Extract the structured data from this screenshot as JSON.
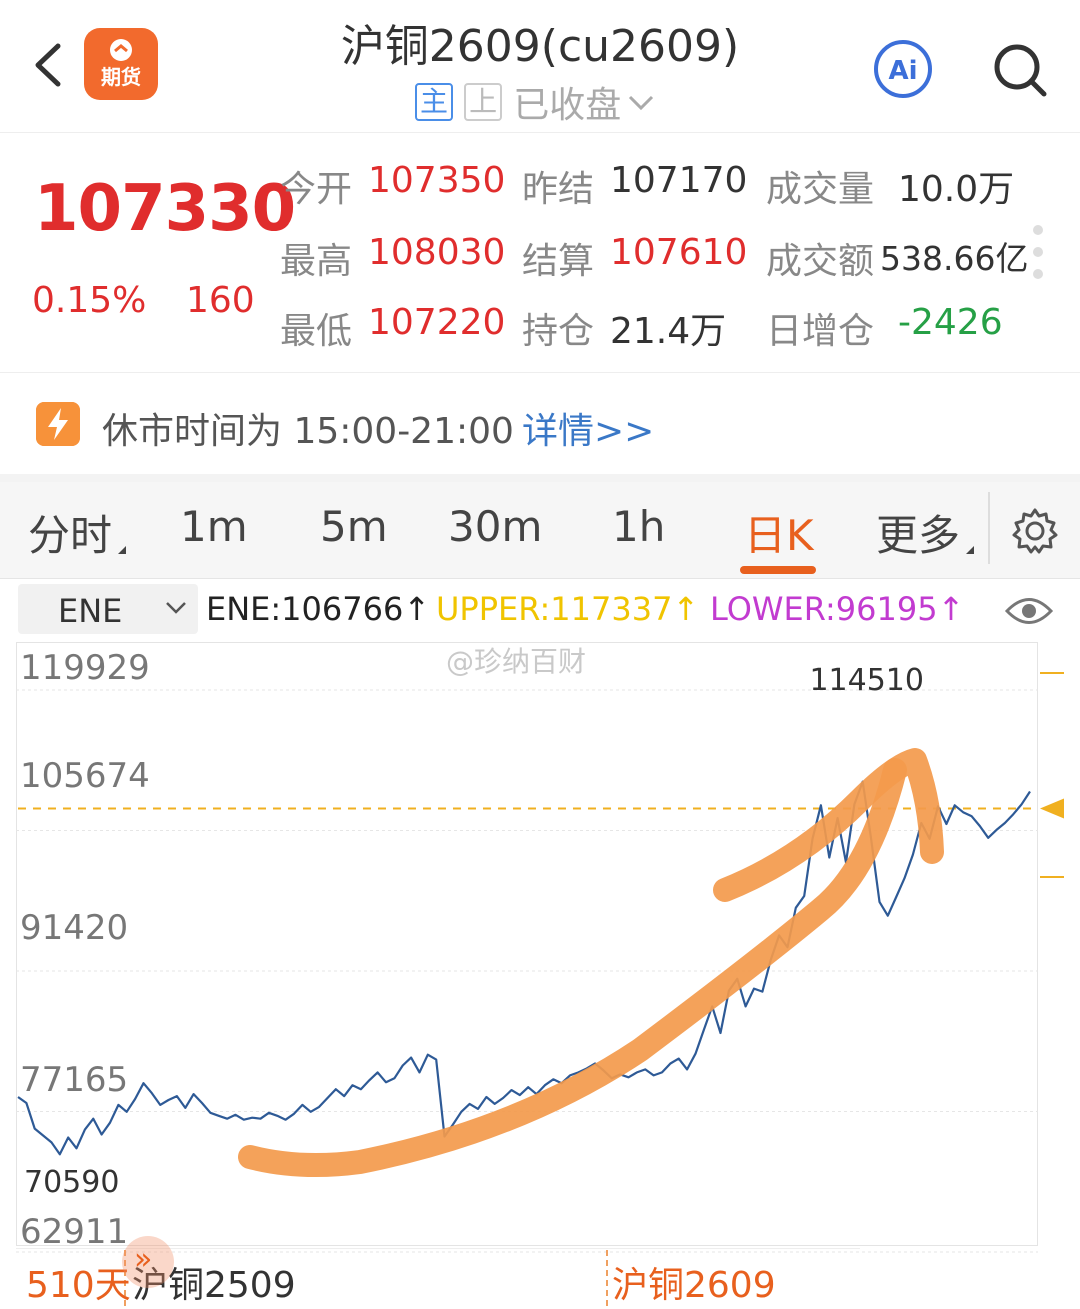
{
  "header": {
    "title": "沪铜2609(cu2609)",
    "tag_main": "主",
    "tag_prev": "上",
    "status": "已收盘",
    "logo_text": "期货"
  },
  "quote": {
    "last_price": "107330",
    "change_pct": "0.15%",
    "change_abs": "160",
    "fields": {
      "open_label": "今开",
      "open_value": "107350",
      "prev_close_label": "昨结",
      "prev_close_value": "107170",
      "volume_label": "成交量",
      "volume_value": "10.0万",
      "high_label": "最高",
      "high_value": "108030",
      "settle_label": "结算",
      "settle_value": "107610",
      "turnover_label": "成交额",
      "turnover_value": "538.66亿",
      "low_label": "最低",
      "low_value": "107220",
      "oi_label": "持仓",
      "oi_value": "21.4万",
      "oi_change_label": "日增仓",
      "oi_change_value": "-2426"
    }
  },
  "notice": {
    "text": "休市时间为 15:00-21:00",
    "link": "详情>>"
  },
  "tabs": [
    {
      "label": "分时"
    },
    {
      "label": "1m"
    },
    {
      "label": "5m"
    },
    {
      "label": "30m"
    },
    {
      "label": "1h"
    },
    {
      "label": "日K"
    },
    {
      "label": "更多"
    }
  ],
  "indicator": {
    "selected": "ENE",
    "ene": "ENE:106766↑",
    "upper": "UPPER:117337↑",
    "lower": "LOWER:96195↑"
  },
  "watermark": "@珍纳百财",
  "colors": {
    "accent": "#e8601e",
    "up": "#e02d2d",
    "down": "#26a046",
    "price_line": "#2e5a96",
    "ref_line": "#f0b020",
    "annotation": "#f39a4c"
  },
  "chart_data": {
    "type": "line",
    "y_ticks": [
      "119929",
      "105674",
      "91420",
      "77165",
      "62911"
    ],
    "ylim": [
      62911,
      119929
    ],
    "max_label": "114510",
    "min_label": "70590",
    "ref_value": 105674,
    "series": [
      {
        "values": [
          76400,
          75800,
          73200,
          72500,
          71800,
          70590,
          72300,
          71200,
          73100,
          74200,
          72600,
          73800,
          75600,
          74900,
          76200,
          77800,
          76800,
          75600,
          76100,
          76500,
          75300,
          76700,
          75800,
          74800,
          74500,
          74200,
          74600,
          74100,
          74300,
          74200,
          74800,
          74500,
          74100,
          74700,
          75600,
          74900,
          75400,
          76300,
          77200,
          76500,
          77600,
          77200,
          78100,
          78900,
          77900,
          78300,
          79600,
          80400,
          78900,
          80700,
          80200,
          72400,
          73600,
          74900,
          75700,
          75200,
          76400,
          75700,
          76300,
          77100,
          76600,
          77400,
          76700,
          77600,
          78200,
          77800,
          78600,
          78900,
          79300,
          79800,
          79100,
          78300,
          78700,
          78400,
          78900,
          79200,
          78600,
          78900,
          79800,
          80300,
          79200,
          80800,
          83200,
          85600,
          82900,
          87200,
          88400,
          85600,
          87400,
          87100,
          90300,
          92800,
          91600,
          95600,
          96800,
          102600,
          106000,
          100700,
          104700,
          100200,
          106100,
          108400,
          102600,
          96200,
          94800,
          96700,
          98600,
          101000,
          104200,
          102600,
          105900,
          104100,
          106000,
          105300,
          104900,
          103900,
          102700,
          103500,
          104200,
          105100,
          106100,
          107400
        ]
      }
    ],
    "bottom_labels": {
      "days": "510天",
      "contract_old": "沪铜2509",
      "contract_new": "沪铜2609"
    }
  }
}
